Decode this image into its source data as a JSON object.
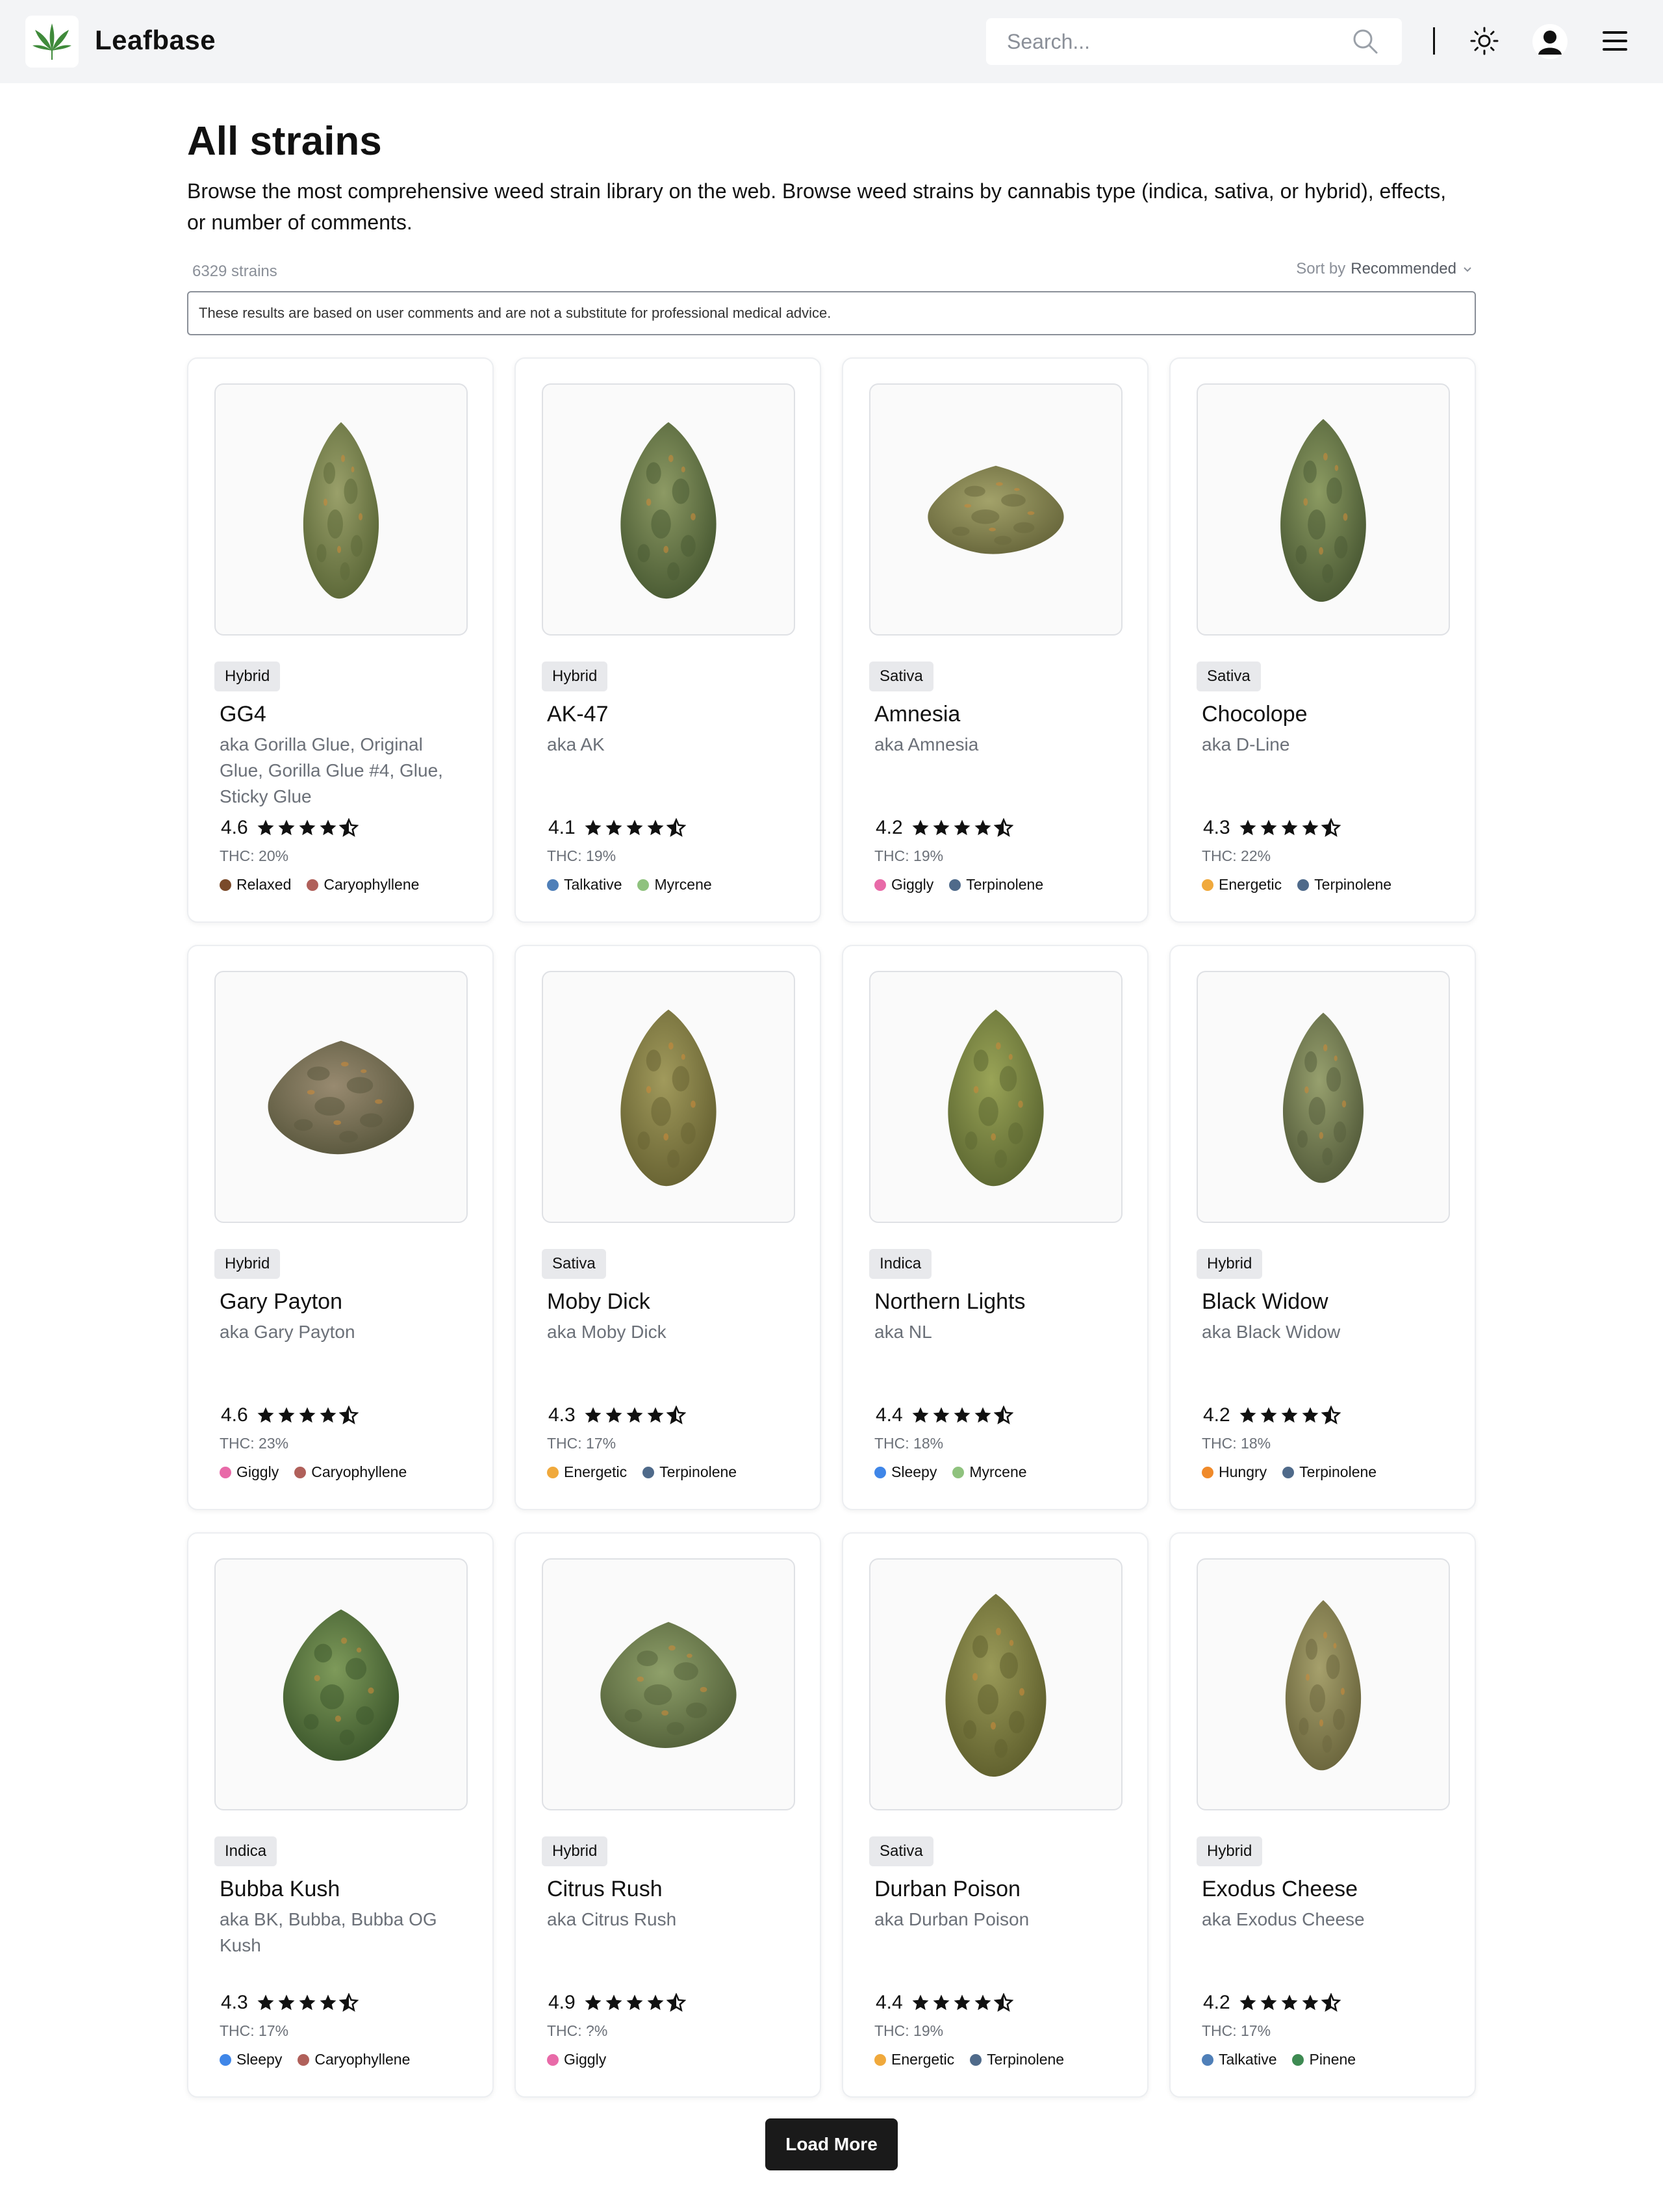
{
  "header": {
    "brand": "Leafbase",
    "search_placeholder": "Search...",
    "icons": [
      "leaf-logo-icon",
      "search-icon",
      "sun-icon",
      "user-avatar-icon",
      "hamburger-menu-icon"
    ]
  },
  "intro": {
    "title": "All strains",
    "description": "Browse the most comprehensive weed strain library on the web. Browse weed strains by cannabis type (indica, sativa, or hybrid), effects, or number of comments.",
    "count": "6329 strains",
    "sort_label": "Sort by",
    "sort_value": "Recommended",
    "disclaimer": "These results are based on user comments and are not a substitute for professional medical advice."
  },
  "colors": {
    "relaxed": "#7a4a2a",
    "caryophyllene": "#b0605a",
    "talkative": "#4f7fb8",
    "myrcene": "#8fc27e",
    "giggly": "#e86aa8",
    "terpinolene": "#4f6a8a",
    "energetic": "#f0a93c",
    "sleepy": "#3f86e8",
    "hungry": "#f08a2a",
    "pinene": "#3e8a52"
  },
  "strains": [
    {
      "type": "Hybrid",
      "name": "GG4",
      "aka": "aka Gorilla Glue, Original Glue, Gorilla Glue #4, Glue, Sticky Glue",
      "rating": "4.6",
      "thc": "THC: 20%",
      "tags": [
        {
          "label": "Relaxed",
          "color": "#7a4a2a"
        },
        {
          "label": "Caryophyllene",
          "color": "#b0605a"
        }
      ]
    },
    {
      "type": "Hybrid",
      "name": "AK-47",
      "aka": "aka AK",
      "rating": "4.1",
      "thc": "THC: 19%",
      "tags": [
        {
          "label": "Talkative",
          "color": "#4f7fb8"
        },
        {
          "label": "Myrcene",
          "color": "#8fc27e"
        }
      ]
    },
    {
      "type": "Sativa",
      "name": "Amnesia",
      "aka": "aka Amnesia",
      "rating": "4.2",
      "thc": "THC: 19%",
      "tags": [
        {
          "label": "Giggly",
          "color": "#e86aa8"
        },
        {
          "label": "Terpinolene",
          "color": "#4f6a8a"
        }
      ]
    },
    {
      "type": "Sativa",
      "name": "Chocolope",
      "aka": "aka D-Line",
      "rating": "4.3",
      "thc": "THC: 22%",
      "tags": [
        {
          "label": "Energetic",
          "color": "#f0a93c"
        },
        {
          "label": "Terpinolene",
          "color": "#4f6a8a"
        }
      ]
    },
    {
      "type": "Hybrid",
      "name": "Gary Payton",
      "aka": "aka Gary Payton",
      "rating": "4.6",
      "thc": "THC: 23%",
      "tags": [
        {
          "label": "Giggly",
          "color": "#e86aa8"
        },
        {
          "label": "Caryophyllene",
          "color": "#b0605a"
        }
      ]
    },
    {
      "type": "Sativa",
      "name": "Moby Dick",
      "aka": "aka Moby Dick",
      "rating": "4.3",
      "thc": "THC: 17%",
      "tags": [
        {
          "label": "Energetic",
          "color": "#f0a93c"
        },
        {
          "label": "Terpinolene",
          "color": "#4f6a8a"
        }
      ]
    },
    {
      "type": "Indica",
      "name": "Northern Lights",
      "aka": "aka NL",
      "rating": "4.4",
      "thc": "THC: 18%",
      "tags": [
        {
          "label": "Sleepy",
          "color": "#3f86e8"
        },
        {
          "label": "Myrcene",
          "color": "#8fc27e"
        }
      ]
    },
    {
      "type": "Hybrid",
      "name": "Black Widow",
      "aka": "aka Black Widow",
      "rating": "4.2",
      "thc": "THC: 18%",
      "tags": [
        {
          "label": "Hungry",
          "color": "#f08a2a"
        },
        {
          "label": "Terpinolene",
          "color": "#4f6a8a"
        }
      ]
    },
    {
      "type": "Indica",
      "name": "Bubba Kush",
      "aka": "aka BK, Bubba, Bubba OG Kush",
      "rating": "4.3",
      "thc": "THC: 17%",
      "tags": [
        {
          "label": "Sleepy",
          "color": "#3f86e8"
        },
        {
          "label": "Caryophyllene",
          "color": "#b0605a"
        }
      ]
    },
    {
      "type": "Hybrid",
      "name": "Citrus Rush",
      "aka": "aka Citrus Rush",
      "rating": "4.9",
      "thc": "THC: ?%",
      "tags": [
        {
          "label": "Giggly",
          "color": "#e86aa8"
        }
      ]
    },
    {
      "type": "Sativa",
      "name": "Durban Poison",
      "aka": "aka Durban Poison",
      "rating": "4.4",
      "thc": "THC: 19%",
      "tags": [
        {
          "label": "Energetic",
          "color": "#f0a93c"
        },
        {
          "label": "Terpinolene",
          "color": "#4f6a8a"
        }
      ]
    },
    {
      "type": "Hybrid",
      "name": "Exodus Cheese",
      "aka": "aka Exodus Cheese",
      "rating": "4.2",
      "thc": "THC: 17%",
      "tags": [
        {
          "label": "Talkative",
          "color": "#4f7fb8"
        },
        {
          "label": "Pinene",
          "color": "#3e8a52"
        }
      ]
    }
  ],
  "load_more_label": "Load More"
}
